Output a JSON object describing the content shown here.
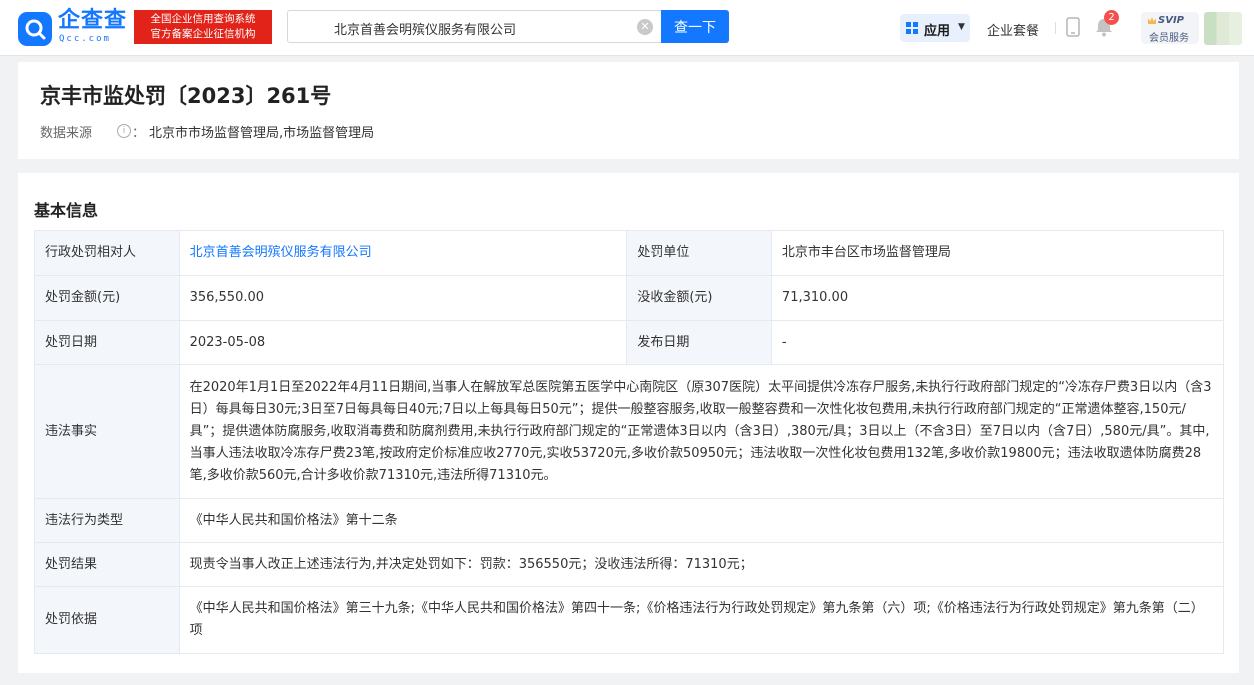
{
  "header": {
    "logo_text": "企查查",
    "logo_sub": "Qcc.com",
    "badge_line1": "全国企业信用查询系统",
    "badge_line2": "官方备案企业征信机构",
    "search_value": "北京首善会明殡仪服务有限公司",
    "search_button": "查一下",
    "app_label": "应用",
    "package_label": "企业套餐",
    "notification_count": "2",
    "svip_line1": "SVIP",
    "svip_line2": "会员服务"
  },
  "title_card": {
    "title": "京丰市监处罚〔2023〕261号",
    "source_label": "数据来源",
    "source_sep": "：",
    "source_value": "北京市市场监督管理局,市场监督管理局"
  },
  "basic_info": {
    "heading": "基本信息",
    "rows": {
      "party_label": "行政处罚相对人",
      "party_value": "北京首善会明殡仪服务有限公司",
      "unit_label": "处罚单位",
      "unit_value": "北京市丰台区市场监督管理局",
      "amount_label": "处罚金额(元)",
      "amount_value": "356,550.00",
      "confiscate_label": "没收金额(元)",
      "confiscate_value": "71,310.00",
      "date_label": "处罚日期",
      "date_value": "2023-05-08",
      "publish_label": "发布日期",
      "publish_value": "-",
      "facts_label": "违法事实",
      "facts_value": "在2020年1月1日至2022年4月11日期间,当事人在解放军总医院第五医学中心南院区（原307医院）太平间提供冷冻存尸服务,未执行行政府部门规定的“冷冻存尸费3日以内（含3日）每具每日30元;3日至7日每具每日40元;7日以上每具每日50元”；提供一般整容服务,收取一般整容费和一次性化妆包费用,未执行行政府部门规定的“正常遗体整容,150元/具”；提供遗体防腐服务,收取消毒费和防腐剂费用,未执行行政府部门规定的“正常遗体3日以内（含3日）,380元/具；3日以上（不含3日）至7日以内（含7日）,580元/具”。其中,当事人违法收取冷冻存尸费23笔,按政府定价标准应收2770元,实收53720元,多收价款50950元；违法收取一次性化妆包费用132笔,多收价款19800元；违法收取遗体防腐费28笔,多收价款560元,合计多收价款71310元,违法所得71310元。",
      "type_label": "违法行为类型",
      "type_value": "《中华人民共和国价格法》第十二条",
      "result_label": "处罚结果",
      "result_value": "现责令当事人改正上述违法行为,并决定处罚如下：罚款：356550元；没收违法所得：71310元；",
      "basis_label": "处罚依据",
      "basis_value": "《中华人民共和国价格法》第三十九条;《中华人民共和国价格法》第四十一条;《价格违法行为行政处罚规定》第九条第（六）项;《价格违法行为行政处罚规定》第九条第（二）项"
    }
  },
  "colors": {
    "brand_blue": "#1377ff",
    "badge_red": "#e2231a",
    "label_bg": "#f3f6fb",
    "page_bg": "#f1f2f4"
  }
}
